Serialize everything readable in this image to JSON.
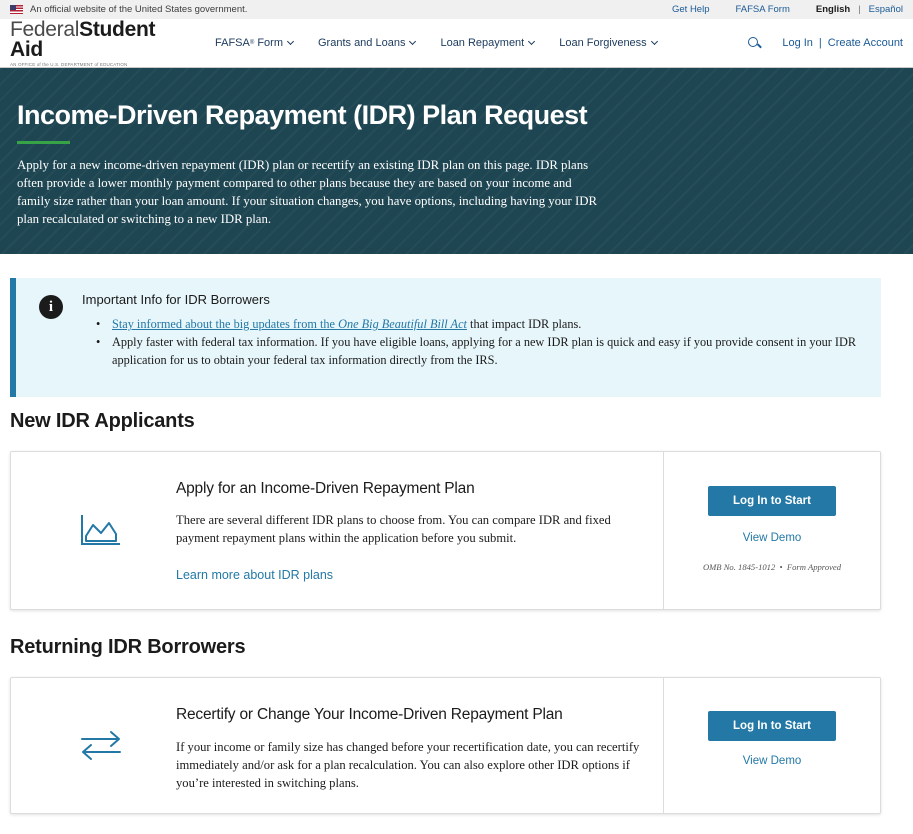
{
  "gov_banner": {
    "text": "An official website of the United States government.",
    "links": [
      "Get Help",
      "FAFSA Form"
    ],
    "lang_active": "English",
    "lang_separator": "|",
    "lang_other": "Español"
  },
  "header": {
    "logo_light": "Federal",
    "logo_bold": "Student Aid",
    "logo_sub": "AN OFFICE of the U.S. DEPARTMENT of EDUCATION",
    "nav": [
      {
        "label": "FAFSA",
        "sup": "®",
        "suffix": " Form"
      },
      {
        "label": "Grants and Loans"
      },
      {
        "label": "Loan Repayment"
      },
      {
        "label": "Loan Forgiveness"
      }
    ],
    "login": "Log In",
    "separator": "|",
    "create": "Create Account"
  },
  "hero": {
    "title": "Income-Driven Repayment (IDR) Plan Request",
    "description": "Apply for a new income-driven repayment (IDR) plan or recertify an existing IDR plan on this page. IDR plans often provide a lower monthly payment compared to other plans because they are based on your income and family size rather than your loan amount. If your situation changes, you have options, including having your IDR plan recalculated or switching to a new IDR plan."
  },
  "info": {
    "icon": "i",
    "title": "Important Info for IDR Borrowers",
    "item1_link": "Stay informed about the big updates from the ",
    "item1_link_italic": "One Big Beautiful Bill Act",
    "item1_rest": " that impact IDR plans.",
    "item2": "Apply faster with federal tax information. If you have eligible loans, applying for a new IDR plan is quick and easy if you provide consent in your IDR application for us to obtain your federal tax information directly from the IRS."
  },
  "new_section": {
    "title": "New IDR Applicants",
    "card_title": "Apply for an Income-Driven Repayment Plan",
    "card_text": "There are several different IDR plans to choose from. You can compare IDR and fixed payment repayment plans within the application before you submit.",
    "card_link": "Learn more about IDR plans",
    "button": "Log In to Start",
    "demo": "View Demo",
    "omb": "OMB No. 1845-1012  •  Form Approved",
    "icon": "chart-icon"
  },
  "returning_section": {
    "title": "Returning IDR Borrowers",
    "card_title": "Recertify or Change Your Income-Driven Repayment Plan",
    "card_text": "If your income or family size has changed before your recertification date, you can recertify immediately and/or ask for a plan recalculation. You can also explore other IDR options if you’re interested in switching plans.",
    "button": "Log In to Start",
    "demo": "View Demo",
    "icon": "swap-arrows-icon"
  },
  "colors": {
    "hero_bg": "#1e4552",
    "accent_green": "#37a347",
    "link_blue": "#2378a6",
    "info_bg": "#e7f6fb"
  }
}
